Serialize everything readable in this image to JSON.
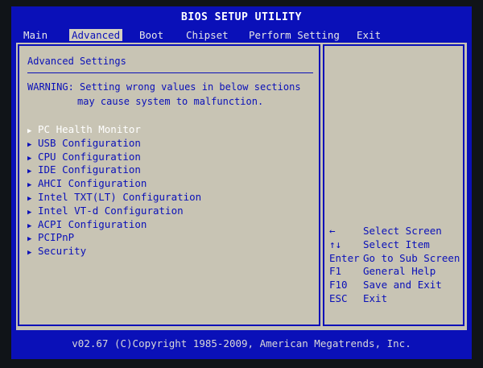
{
  "title": "BIOS SETUP UTILITY",
  "menu": [
    {
      "label": "Main",
      "active": false
    },
    {
      "label": "Advanced",
      "active": true
    },
    {
      "label": "Boot",
      "active": false
    },
    {
      "label": "Chipset",
      "active": false
    },
    {
      "label": "Perform Setting",
      "active": false
    },
    {
      "label": "Exit",
      "active": false
    }
  ],
  "section_title": "Advanced Settings",
  "warning": {
    "line1": "WARNING: Setting wrong values in below sections",
    "line2": "may cause system to malfunction."
  },
  "items": [
    {
      "label": "PC Health Monitor",
      "selected": true
    },
    {
      "label": "USB Configuration",
      "selected": false
    },
    {
      "label": "CPU Configuration",
      "selected": false
    },
    {
      "label": "IDE Configuration",
      "selected": false
    },
    {
      "label": "AHCI Configuration",
      "selected": false
    },
    {
      "label": "Intel TXT(LT) Configuration",
      "selected": false
    },
    {
      "label": "Intel VT-d Configuration",
      "selected": false
    },
    {
      "label": "ACPI Configuration",
      "selected": false
    },
    {
      "label": "PCIPnP",
      "selected": false
    },
    {
      "label": "Security",
      "selected": false
    }
  ],
  "help": [
    {
      "key": "←",
      "desc": "Select Screen"
    },
    {
      "key": "↑↓",
      "desc": "Select Item"
    },
    {
      "key": "Enter",
      "desc": "Go to Sub Screen"
    },
    {
      "key": "F1",
      "desc": "General Help"
    },
    {
      "key": "F10",
      "desc": "Save and Exit"
    },
    {
      "key": "ESC",
      "desc": "Exit"
    }
  ],
  "footer": "v02.67 (C)Copyright 1985-2009, American Megatrends, Inc.",
  "colors": {
    "background_blue": "#0a10b8",
    "panel_gray": "#c8c4b4",
    "selected_text": "#ffffff"
  }
}
